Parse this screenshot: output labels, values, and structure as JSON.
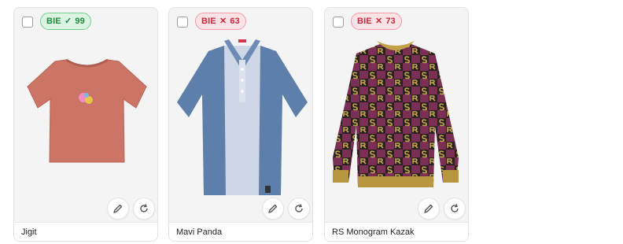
{
  "cards": [
    {
      "name": "Jigit",
      "badge": {
        "text": "BIE",
        "mark": "✓",
        "score": "99",
        "status": "pass"
      },
      "image": "salmon t-shirt"
    },
    {
      "name": "Mavi Panda",
      "badge": {
        "text": "BIE",
        "mark": "✕",
        "score": "63",
        "status": "fail"
      },
      "image": "blue striped polo"
    },
    {
      "name": "RS Monogram Kazak",
      "badge": {
        "text": "BIE",
        "mark": "✕",
        "score": "73",
        "status": "fail"
      },
      "image": "monogram knit sweater"
    }
  ],
  "icons": {
    "edit": "pencil-icon",
    "refresh": "refresh-icon"
  },
  "colors": {
    "pass": "#1b8a3f",
    "fail": "#c8283c"
  }
}
